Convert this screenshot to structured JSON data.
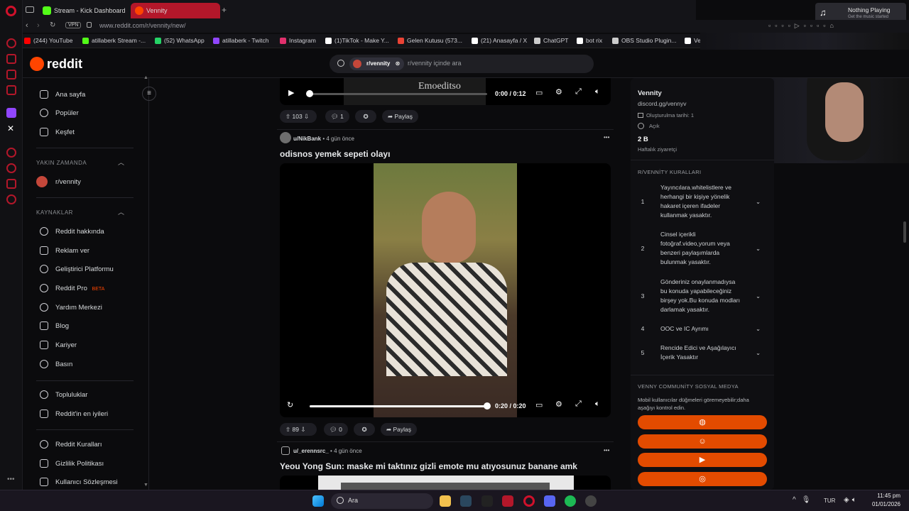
{
  "browser": {
    "tabs": [
      {
        "label": "Stream - Kick Dashboard",
        "color": "#53fc18"
      },
      {
        "label": "Vennity",
        "color": "#ff4500"
      }
    ],
    "vpn": "VPN",
    "url": "www.reddit.com/r/vennity/new/",
    "bookmarks": [
      {
        "label": "(244) YouTube",
        "color": "#ff0000"
      },
      {
        "label": "atillaberk Stream -...",
        "color": "#53fc18"
      },
      {
        "label": "(52) WhatsApp",
        "color": "#25d366"
      },
      {
        "label": "atillaberk - Twitch",
        "color": "#9146ff"
      },
      {
        "label": "Instagram",
        "color": "#e1306c"
      },
      {
        "label": "(1)TikTok - Make Y...",
        "color": "#ffffff"
      },
      {
        "label": "Gelen Kutusu (573...",
        "color": "#ea4335"
      },
      {
        "label": "(21) Anasayfa / X",
        "color": "#ffffff"
      },
      {
        "label": "ChatGPT",
        "color": "#cccccc"
      },
      {
        "label": "bot rix",
        "color": "#ffffff"
      },
      {
        "label": "OBS Studio Plugin...",
        "color": "#cccccc"
      },
      {
        "label": "Ve",
        "color": "#ffffff"
      }
    ],
    "nothing_playing": "Nothing Playing",
    "nothing_playing_sub": "Get the music started"
  },
  "header": {
    "logo": "reddit",
    "chip": "r/vennity",
    "search_placeholder": "r/vennity içinde ara"
  },
  "sidebar": {
    "main": [
      "Ana sayfa",
      "Popüler",
      "Keşfet"
    ],
    "recent_title": "YAKIN ZAMANDA",
    "recent": [
      "r/vennity"
    ],
    "resources_title": "KAYNAKLAR",
    "resources": [
      "Reddit hakkında",
      "Reklam ver",
      "Geliştirici Platformu",
      "Reddit Pro",
      "Yardım Merkezi",
      "Blog",
      "Kariyer",
      "Basın"
    ],
    "beta": "BETA",
    "community": [
      "Topluluklar",
      "Reddit'in en iyileri"
    ],
    "legal": [
      "Reddit Kuralları",
      "Gizlilik Politikası",
      "Kullanıcı Sözleşmesi"
    ]
  },
  "feed": {
    "top_video": {
      "watermark": "Emoeditso",
      "time": "0:00 / 0:12",
      "progress": 0.0
    },
    "top_actions": {
      "votes": "103",
      "comments": "1",
      "share": "Paylaş"
    },
    "post1": {
      "author": "u/NikBank",
      "age": "4 gün önce",
      "title": "odisnos yemek sepeti olayı",
      "time": "0:20 / 0:20",
      "progress": 1.0,
      "votes": "89",
      "comments": "0",
      "share": "Paylaş"
    },
    "post2": {
      "author": "u/_erennsrc_",
      "age": "4 gün önce",
      "title": "Yeou Yong Sun: maske mi taktınız gizli emote mu atıyosunuz banane amk"
    },
    "more": "•••"
  },
  "right": {
    "name": "Vennity",
    "link": "discord.gg/vennyv",
    "created": "Oluşturulma tarihi: 1",
    "status": "Açık",
    "weekly_count": "2 B",
    "weekly_label": "Haftalık ziyaretçi",
    "rules_title": "R/VENNİTY KURALLARI",
    "rules": [
      {
        "n": "1",
        "text": "Yayıncılara.whitelistlere ve herhangi bir kişiye yönelik hakaret içeren ifadeler kullanmak yasaktır."
      },
      {
        "n": "2",
        "text": "Cinsel içerikli fotoğraf.video,yorum veya benzeri paylaşımlarda bulunmak yasaktır."
      },
      {
        "n": "3",
        "text": "Gönderiniz onaylanmadıysa bu konuda yapabileceğiniz birşey yok.Bu konuda modları darlamak yasaktır."
      },
      {
        "n": "4",
        "text": "OOC ve IC Ayrımı"
      },
      {
        "n": "5",
        "text": "Rencide Edici ve Aşağılayıcı İçerik Yasaktır"
      }
    ],
    "social_title": "VENNY COMMUNİTY SOSYAL MEDYA",
    "social_note": "Mobil kullanıcılar düğmeleri göremeyebilir;daha aşağıyı kontrol edin.",
    "social_icons": [
      "globe-icon",
      "discord-icon",
      "youtube-icon",
      "instagram-icon"
    ]
  },
  "taskbar": {
    "search": "Ara",
    "lang": "TUR",
    "time": "11:45 pm",
    "date": "01/01/2026"
  },
  "colors": {
    "accent": "#ff4500",
    "button": "#e34b00",
    "tab_active": "#b3172a"
  }
}
